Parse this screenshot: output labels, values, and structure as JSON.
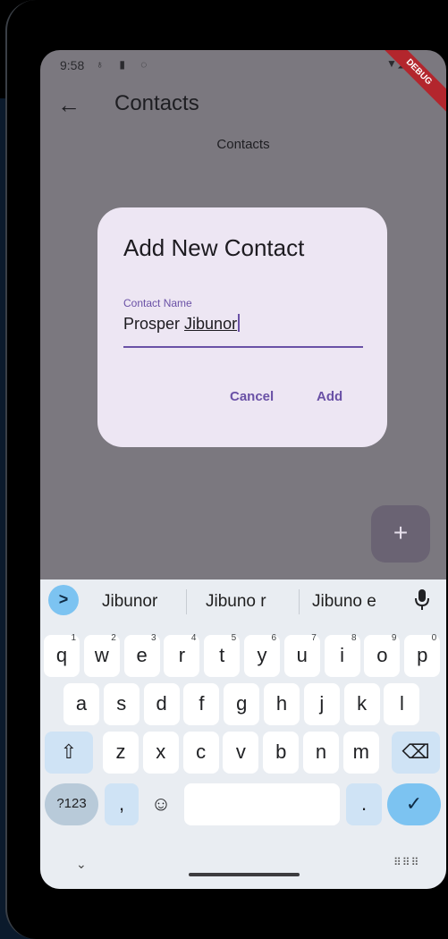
{
  "status_bar": {
    "time": "9:58",
    "left_icons": "♁ ▮ ◌",
    "right_icons": "▼◢▮"
  },
  "debug_banner": "DEBUG",
  "app_bar": {
    "title": "Contacts"
  },
  "page": {
    "subtitle": "Contacts"
  },
  "dialog": {
    "title": "Add New Contact",
    "field_label": "Contact Name",
    "field_value_part1": "Prosper ",
    "field_value_part2": "Jibunor",
    "cancel_label": "Cancel",
    "add_label": "Add"
  },
  "fab": {
    "label": "+"
  },
  "keyboard": {
    "suggestions": [
      "Jibunor",
      "Jibuno r",
      "Jibuno e"
    ],
    "row1": [
      {
        "k": "q",
        "n": "1"
      },
      {
        "k": "w",
        "n": "2"
      },
      {
        "k": "e",
        "n": "3"
      },
      {
        "k": "r",
        "n": "4"
      },
      {
        "k": "t",
        "n": "5"
      },
      {
        "k": "y",
        "n": "6"
      },
      {
        "k": "u",
        "n": "7"
      },
      {
        "k": "i",
        "n": "8"
      },
      {
        "k": "o",
        "n": "9"
      },
      {
        "k": "p",
        "n": "0"
      }
    ],
    "row2": [
      "a",
      "s",
      "d",
      "f",
      "g",
      "h",
      "j",
      "k",
      "l"
    ],
    "row3": [
      "z",
      "x",
      "c",
      "v",
      "b",
      "n",
      "m"
    ],
    "numbers_label": "?123",
    "comma_label": ",",
    "period_label": ".",
    "shift_icon": "⇧",
    "emoji_icon": "☺",
    "backspace_icon": "⌫",
    "enter_icon": "✓",
    "suggestion_chevron": ">",
    "nav_chevron": "⌄",
    "keyboard_switch_icon": "⠿⠿⠿"
  },
  "colors": {
    "dim_background": "#7b787f",
    "dialog_background": "#ede6f3",
    "accent": "#6a51a6",
    "keyboard_background": "#e9edf2",
    "enter_key": "#7cc3f1"
  }
}
